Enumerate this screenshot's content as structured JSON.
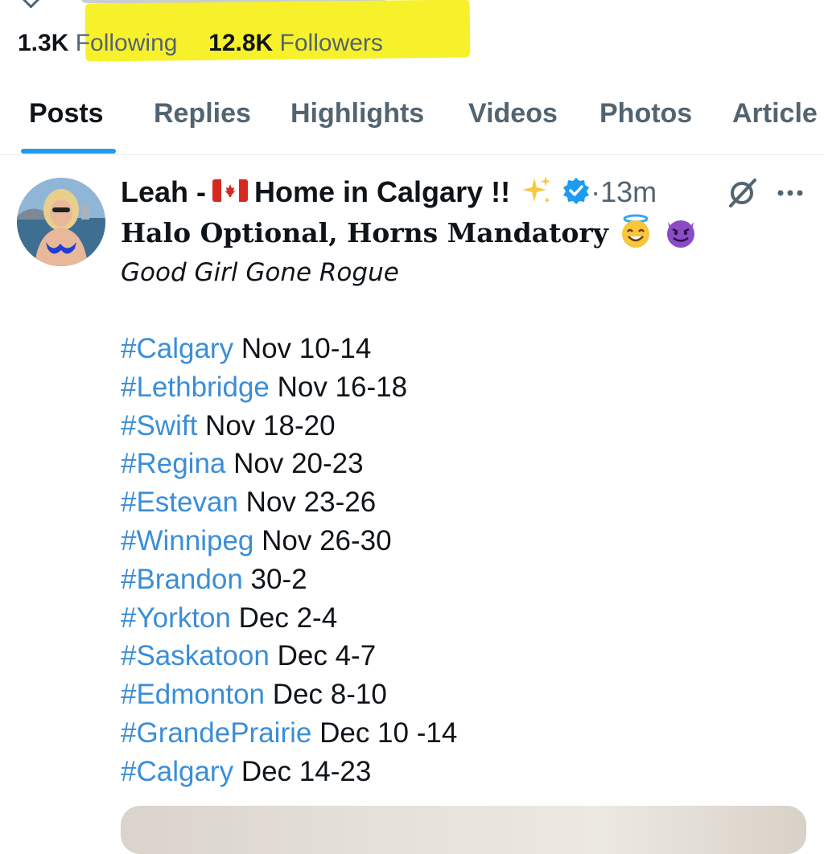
{
  "profile": {
    "following_count": "1.3K",
    "following_label": "Following",
    "followers_count": "12.8K",
    "followers_label": "Followers"
  },
  "tabs": [
    {
      "label": "Posts",
      "active": true
    },
    {
      "label": "Replies"
    },
    {
      "label": "Highlights"
    },
    {
      "label": "Videos"
    },
    {
      "label": "Photos"
    },
    {
      "label": "Article"
    }
  ],
  "post": {
    "author_prefix": "Leah -",
    "author_suffix": "Home in Calgary !!",
    "flag_icon": "canada-flag-icon",
    "sparkle_icon": "sparkles-icon",
    "verified_icon": "verified-badge-icon",
    "verified_color": "#1d9bf0",
    "time_separator": "·",
    "timestamp": "13m",
    "bio_title": "Halo Optional, Horns Mandatory",
    "bio_subtitle": "Good Girl Gone Rogue",
    "hashtag_color": "#3a8ed8",
    "schedule": [
      {
        "tag": "#Calgary",
        "dates": "Nov 10-14"
      },
      {
        "tag": "#Lethbridge",
        "dates": "Nov 16-18"
      },
      {
        "tag": "#Swift",
        "dates": "Nov 18-20"
      },
      {
        "tag": "#Regina",
        "dates": "Nov 20-23"
      },
      {
        "tag": "#Estevan",
        "dates": "Nov 23-26"
      },
      {
        "tag": "#Winnipeg",
        "dates": "Nov 26-30"
      },
      {
        "tag": "#Brandon",
        "dates": "30-2"
      },
      {
        "tag": "#Yorkton",
        "dates": "Dec 2-4"
      },
      {
        "tag": "#Saskatoon",
        "dates": "Dec 4-7"
      },
      {
        "tag": "#Edmonton",
        "dates": "Dec 8-10"
      },
      {
        "tag": "#GrandePrairie",
        "dates": "Dec 10 -14"
      },
      {
        "tag": "#Calgary",
        "dates": "Dec 14-23"
      }
    ]
  },
  "colors": {
    "highlight": "#f7f12b",
    "accent": "#1d9bf0",
    "muted_text": "#536471"
  }
}
